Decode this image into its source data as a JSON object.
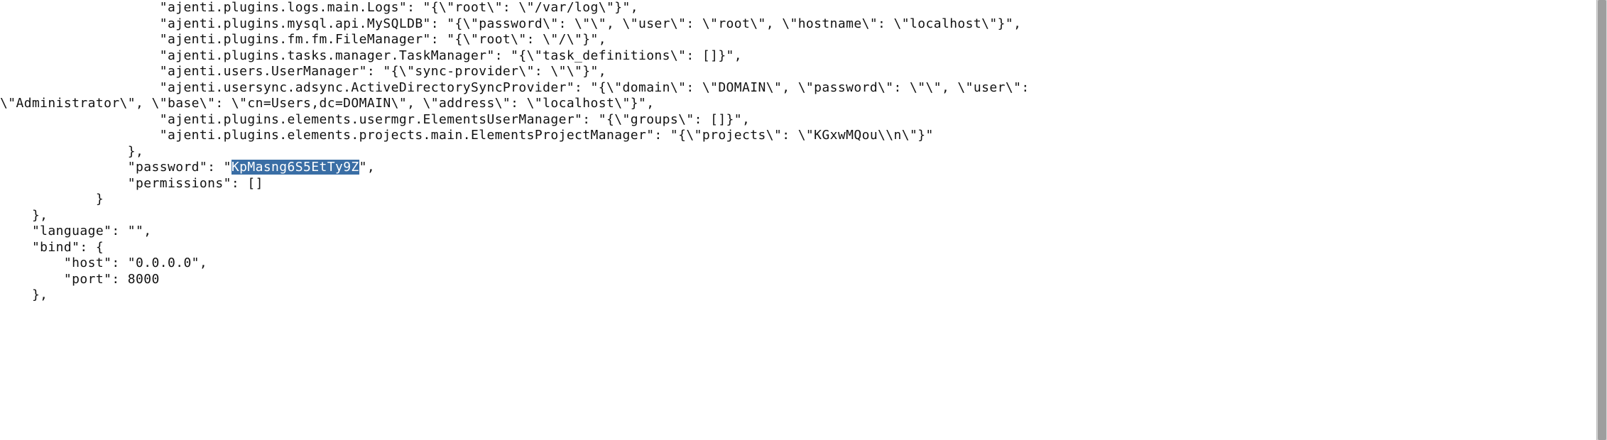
{
  "code": {
    "lines": [
      "                    \"ajenti.plugins.logs.main.Logs\": \"{\\\"root\\\": \\\"/var/log\\\"}\",",
      "                    \"ajenti.plugins.mysql.api.MySQLDB\": \"{\\\"password\\\": \\\"\\\", \\\"user\\\": \\\"root\\\", \\\"hostname\\\": \\\"localhost\\\"}\",",
      "                    \"ajenti.plugins.fm.fm.FileManager\": \"{\\\"root\\\": \\\"/\\\"}\",",
      "                    \"ajenti.plugins.tasks.manager.TaskManager\": \"{\\\"task_definitions\\\": []}\",",
      "                    \"ajenti.users.UserManager\": \"{\\\"sync-provider\\\": \\\"\\\"}\",",
      "                    \"ajenti.usersync.adsync.ActiveDirectorySyncProvider\": \"{\\\"domain\\\": \\\"DOMAIN\\\", \\\"password\\\": \\\"\\\", \\\"user\\\": ",
      "\\\"Administrator\\\", \\\"base\\\": \\\"cn=Users,dc=DOMAIN\\\", \\\"address\\\": \\\"localhost\\\"}\",",
      "                    \"ajenti.plugins.elements.usermgr.ElementsUserManager\": \"{\\\"groups\\\": []}\",",
      "                    \"ajenti.plugins.elements.projects.main.ElementsProjectManager\": \"{\\\"projects\\\": \\\"KGxwMQou\\\\n\\\"}\"",
      "                },",
      "                \"password\": \"",
      "\",",
      "                \"permissions\": []",
      "            }",
      "    },",
      "    \"language\": \"\",",
      "    \"bind\": {",
      "        \"host\": \"0.0.0.0\",",
      "        \"port\": 8000",
      "    },"
    ],
    "selected_password": "KpMasng6S5EtTy9Z"
  },
  "scrollbar": {
    "present": true
  }
}
